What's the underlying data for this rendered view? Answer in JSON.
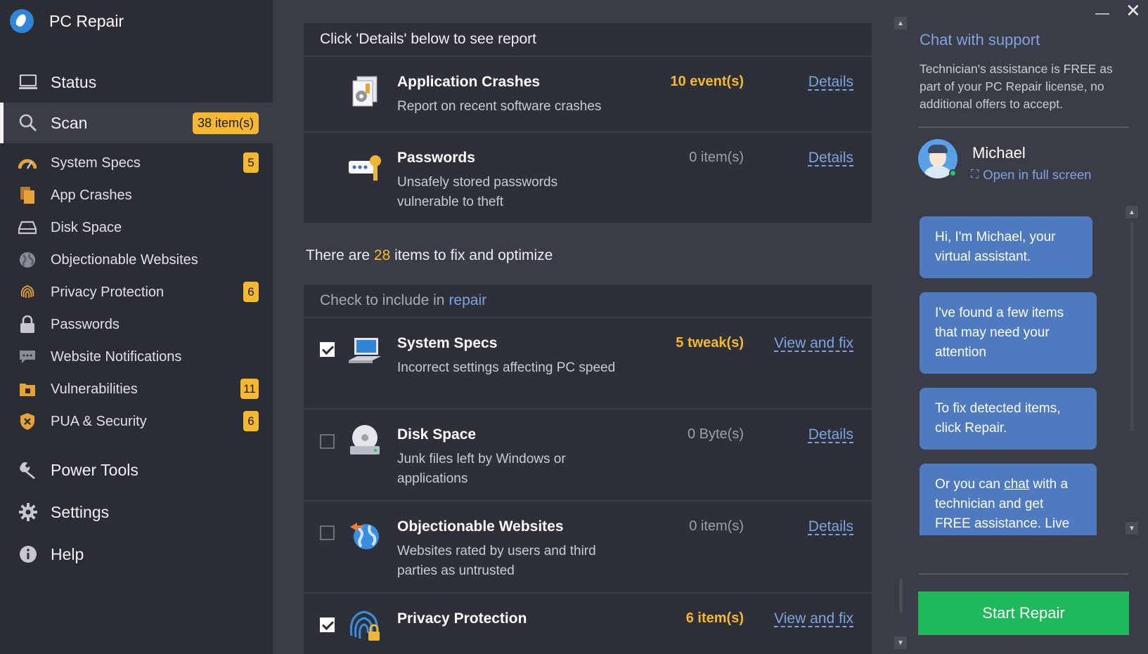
{
  "app": {
    "title": "PC Repair"
  },
  "sidebar": {
    "status": {
      "label": "Status",
      "icon": "monitor-icon"
    },
    "scan": {
      "label": "Scan",
      "badge": "38 item(s)",
      "icon": "magnifier-icon"
    },
    "sub_items": [
      {
        "label": "System Specs",
        "badge": "5",
        "icon": "speedometer-icon"
      },
      {
        "label": "App Crashes",
        "badge": "",
        "icon": "file-icon"
      },
      {
        "label": "Disk Space",
        "badge": "",
        "icon": "drive-icon"
      },
      {
        "label": "Objectionable Websites",
        "badge": "",
        "icon": "globe-icon"
      },
      {
        "label": "Privacy Protection",
        "badge": "6",
        "icon": "fingerprint-icon"
      },
      {
        "label": "Passwords",
        "badge": "",
        "icon": "lock-icon"
      },
      {
        "label": "Website Notifications",
        "badge": "",
        "icon": "chat-bubble-icon"
      },
      {
        "label": "Vulnerabilities",
        "badge": "11",
        "icon": "folder-lock-icon"
      },
      {
        "label": "PUA & Security",
        "badge": "6",
        "icon": "shield-icon"
      }
    ],
    "power_tools": {
      "label": "Power Tools",
      "icon": "wrench-icon"
    },
    "settings": {
      "label": "Settings",
      "icon": "gear-icon"
    },
    "help": {
      "label": "Help",
      "icon": "info-icon"
    }
  },
  "report": {
    "header": "Click 'Details' below to see report",
    "rows": [
      {
        "title": "Application Crashes",
        "desc": "Report on recent software crashes",
        "count": "10 event(s)",
        "link": "Details"
      },
      {
        "title": "Passwords",
        "desc": "Unsafely stored passwords vulnerable to theft",
        "count": "0 item(s)",
        "link": "Details"
      }
    ]
  },
  "summary": {
    "prefix": "There are",
    "count": "28",
    "suffix": "items to fix and optimize"
  },
  "repair": {
    "header_text": "Check to include in",
    "header_accent": "repair",
    "rows": [
      {
        "title": "System Specs",
        "desc": "Incorrect settings affecting PC speed",
        "count": "5 tweak(s)",
        "link": "View and fix",
        "checked": true
      },
      {
        "title": "Disk Space",
        "desc": "Junk files left by Windows or applications",
        "count": "0 Byte(s)",
        "link": "Details",
        "checked": false
      },
      {
        "title": "Objectionable Websites",
        "desc": "Websites rated by users and third parties as untrusted",
        "count": "0 item(s)",
        "link": "Details",
        "checked": false
      },
      {
        "title": "Privacy Protection",
        "desc": "",
        "count": "6 item(s)",
        "link": "View and fix",
        "checked": true
      }
    ]
  },
  "chat": {
    "title": "Chat with support",
    "note": "Technician's assistance is FREE as part of your PC Repair license, no additional offers to accept.",
    "agent_name": "Michael",
    "fullscreen_label": "Open in full screen",
    "messages": [
      "Hi, I'm Michael, your virtual assistant.",
      "I've found a few items that may need your attention",
      "To fix detected items, click Repair."
    ],
    "last_message": {
      "before": "Or you can",
      "link": "chat",
      "after": "with a technician and get FREE assistance. Live"
    },
    "button": "Start Repair"
  },
  "colors": {
    "accent": "#7ea3e0",
    "warning": "#f5b82e",
    "success": "#1fb85a",
    "sidebar_bg": "#2b2d35",
    "panel_bg": "#2e3039"
  }
}
